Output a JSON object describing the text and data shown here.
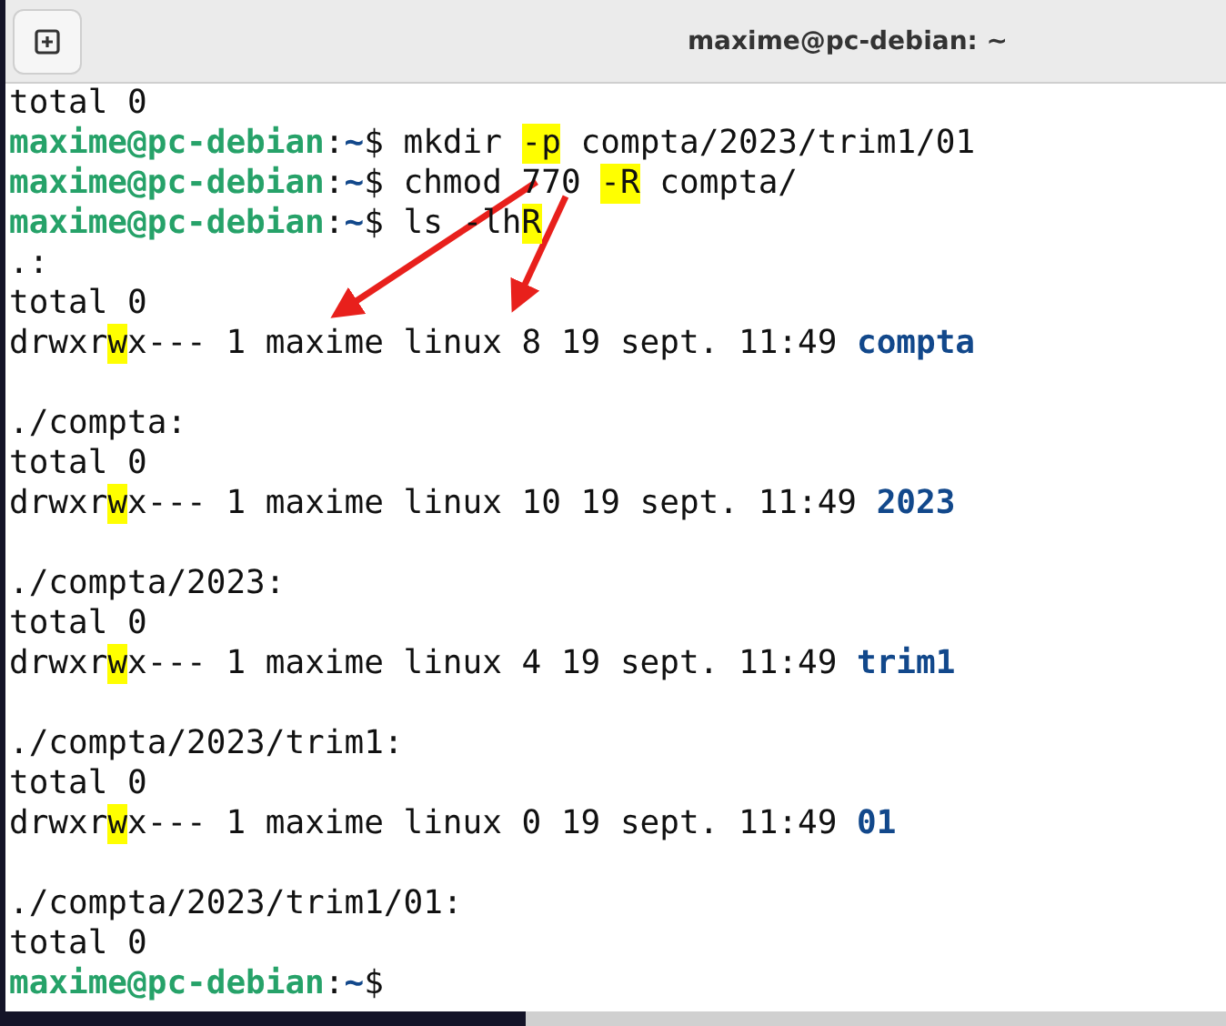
{
  "window": {
    "title": "maxime@pc-debian: ~"
  },
  "blocks": [
    {
      "lines": [
        [
          {
            "kind": "text",
            "text": "total 0",
            "highlight": false
          }
        ],
        [
          {
            "kind": "prompt",
            "text": "maxime@pc-debian",
            "highlight": false
          },
          {
            "kind": "text",
            "text": ":",
            "highlight": false
          },
          {
            "kind": "path",
            "text": "~",
            "highlight": false
          },
          {
            "kind": "text",
            "text": "$ mkdir ",
            "highlight": false
          },
          {
            "kind": "text",
            "text": "-p",
            "highlight": true
          },
          {
            "kind": "text",
            "text": " compta/2023/trim1/01",
            "highlight": false
          }
        ],
        [
          {
            "kind": "prompt",
            "text": "maxime@pc-debian",
            "highlight": false
          },
          {
            "kind": "text",
            "text": ":",
            "highlight": false
          },
          {
            "kind": "path",
            "text": "~",
            "highlight": false
          },
          {
            "kind": "text",
            "text": "$ chmod 770 ",
            "highlight": false
          },
          {
            "kind": "text",
            "text": "-R",
            "highlight": true
          },
          {
            "kind": "text",
            "text": " compta/",
            "highlight": false
          }
        ],
        [
          {
            "kind": "prompt",
            "text": "maxime@pc-debian",
            "highlight": false
          },
          {
            "kind": "text",
            "text": ":",
            "highlight": false
          },
          {
            "kind": "path",
            "text": "~",
            "highlight": false
          },
          {
            "kind": "text",
            "text": "$ ls -lh",
            "highlight": false
          },
          {
            "kind": "text",
            "text": "R",
            "highlight": true
          }
        ],
        [
          {
            "kind": "text",
            "text": ".:",
            "highlight": false
          }
        ],
        [
          {
            "kind": "text",
            "text": "total 0",
            "highlight": false
          }
        ],
        [
          {
            "kind": "text",
            "text": "drwxr",
            "highlight": false
          },
          {
            "kind": "text",
            "text": "w",
            "highlight": true
          },
          {
            "kind": "text",
            "text": "x--- 1 maxime linux 8 19 sept. 11:49 ",
            "highlight": false
          },
          {
            "kind": "dir",
            "text": "compta",
            "highlight": false
          }
        ]
      ]
    },
    {
      "lines": [
        [
          {
            "kind": "text",
            "text": "./compta:",
            "highlight": false
          }
        ],
        [
          {
            "kind": "text",
            "text": "total 0",
            "highlight": false
          }
        ],
        [
          {
            "kind": "text",
            "text": "drwxr",
            "highlight": false
          },
          {
            "kind": "text",
            "text": "w",
            "highlight": true
          },
          {
            "kind": "text",
            "text": "x--- 1 maxime linux 10 19 sept. 11:49 ",
            "highlight": false
          },
          {
            "kind": "dir",
            "text": "2023",
            "highlight": false
          }
        ]
      ]
    },
    {
      "lines": [
        [
          {
            "kind": "text",
            "text": "./compta/2023:",
            "highlight": false
          }
        ],
        [
          {
            "kind": "text",
            "text": "total 0",
            "highlight": false
          }
        ],
        [
          {
            "kind": "text",
            "text": "drwxr",
            "highlight": false
          },
          {
            "kind": "text",
            "text": "w",
            "highlight": true
          },
          {
            "kind": "text",
            "text": "x--- 1 maxime linux 4 19 sept. 11:49 ",
            "highlight": false
          },
          {
            "kind": "dir",
            "text": "trim1",
            "highlight": false
          }
        ]
      ]
    },
    {
      "lines": [
        [
          {
            "kind": "text",
            "text": "./compta/2023/trim1:",
            "highlight": false
          }
        ],
        [
          {
            "kind": "text",
            "text": "total 0",
            "highlight": false
          }
        ],
        [
          {
            "kind": "text",
            "text": "drwxr",
            "highlight": false
          },
          {
            "kind": "text",
            "text": "w",
            "highlight": true
          },
          {
            "kind": "text",
            "text": "x--- 1 maxime linux 0 19 sept. 11:49 ",
            "highlight": false
          },
          {
            "kind": "dir",
            "text": "01",
            "highlight": false
          }
        ]
      ]
    },
    {
      "lines": [
        [
          {
            "kind": "text",
            "text": "./compta/2023/trim1/01:",
            "highlight": false
          }
        ],
        [
          {
            "kind": "text",
            "text": "total 0",
            "highlight": false
          }
        ],
        [
          {
            "kind": "prompt",
            "text": "maxime@pc-debian",
            "highlight": false
          },
          {
            "kind": "text",
            "text": ":",
            "highlight": false
          },
          {
            "kind": "path",
            "text": "~",
            "highlight": false
          },
          {
            "kind": "text",
            "text": "$",
            "highlight": false
          }
        ]
      ]
    }
  ]
}
